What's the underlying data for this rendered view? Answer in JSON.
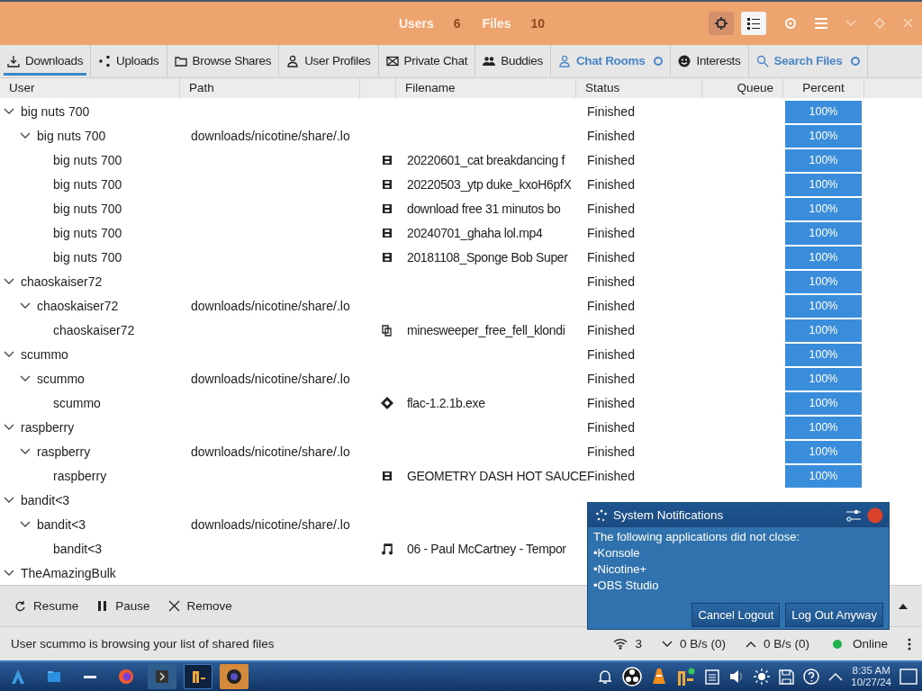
{
  "header": {
    "stats": [
      {
        "label": "Users",
        "value": "6"
      },
      {
        "label": "Files",
        "value": "10"
      }
    ],
    "view_toggle": [
      {
        "kind": "plugin",
        "selected": false
      },
      {
        "kind": "list",
        "selected": true
      }
    ]
  },
  "tabs": [
    {
      "label": "Downloads",
      "kind": "download",
      "selected": true,
      "highlighted": false,
      "dot": false
    },
    {
      "label": "Uploads",
      "kind": "share",
      "selected": false,
      "highlighted": false,
      "dot": false
    },
    {
      "label": "Browse Shares",
      "kind": "folder",
      "selected": false,
      "highlighted": false,
      "dot": false
    },
    {
      "label": "User Profiles",
      "kind": "person",
      "selected": false,
      "highlighted": false,
      "dot": false
    },
    {
      "label": "Private Chat",
      "kind": "mail",
      "selected": false,
      "highlighted": false,
      "dot": false
    },
    {
      "label": "Buddies",
      "kind": "people",
      "selected": false,
      "highlighted": false,
      "dot": false
    },
    {
      "label": "Chat Rooms",
      "kind": "person",
      "selected": false,
      "highlighted": true,
      "dot": true
    },
    {
      "label": "Interests",
      "kind": "smile",
      "selected": false,
      "highlighted": false,
      "dot": false
    },
    {
      "label": "Search Files",
      "kind": "search",
      "selected": false,
      "highlighted": true,
      "dot": true
    }
  ],
  "columns": [
    "User",
    "Path",
    "Filename",
    "Status",
    "Queue",
    "Percent"
  ],
  "rows": [
    {
      "user": "big nuts 700",
      "status": "Finished",
      "percent": "100%",
      "level": 1,
      "expanded": true,
      "children": [
        {
          "user": "big nuts 700",
          "path": "downloads/nicotine/share/.lo",
          "status": "Finished",
          "percent": "100%",
          "level": 1,
          "expanded": true,
          "children": [
            {
              "user": "big nuts 700",
              "kind": "video",
              "file": "20220601_cat breakdancing f",
              "status": "Finished",
              "percent": "100%",
              "level": 1
            },
            {
              "user": "big nuts 700",
              "kind": "video",
              "file": "20220503_ytp duke_kxoH6pfX",
              "status": "Finished",
              "percent": "100%",
              "level": 1
            },
            {
              "user": "big nuts 700",
              "kind": "video",
              "file": "download free 31 minutos bo",
              "status": "Finished",
              "percent": "100%",
              "level": 1
            },
            {
              "user": "big nuts 700",
              "kind": "video",
              "file": "20240701_ghaha lol.mp4",
              "status": "Finished",
              "percent": "100%",
              "level": 1
            },
            {
              "user": "big nuts 700",
              "kind": "video",
              "file": "20181108_Sponge Bob Super",
              "status": "Finished",
              "percent": "100%",
              "level": 1
            }
          ]
        }
      ]
    },
    {
      "user": "chaoskaiser72",
      "status": "Finished",
      "percent": "100%",
      "level": 1,
      "expanded": true,
      "children": [
        {
          "user": "chaoskaiser72",
          "path": "downloads/nicotine/share/.lo",
          "status": "Finished",
          "percent": "100%",
          "level": 1,
          "expanded": true,
          "children": [
            {
              "user": "chaoskaiser72",
              "kind": "document",
              "file": "minesweeper_free_fell_klondi",
              "status": "Finished",
              "percent": "100%",
              "level": 1
            }
          ]
        }
      ]
    },
    {
      "user": "scummo",
      "status": "Finished",
      "percent": "100%",
      "level": 1,
      "expanded": true,
      "children": [
        {
          "user": "scummo",
          "path": "downloads/nicotine/share/.lo",
          "status": "Finished",
          "percent": "100%",
          "level": 1,
          "expanded": true,
          "children": [
            {
              "user": "scummo",
              "kind": "executable",
              "file": "flac-1.2.1b.exe",
              "status": "Finished",
              "percent": "100%",
              "level": 1
            }
          ]
        }
      ]
    },
    {
      "user": "raspberry",
      "status": "Finished",
      "percent": "100%",
      "level": 1,
      "expanded": true,
      "children": [
        {
          "user": "raspberry",
          "path": "downloads/nicotine/share/.lo",
          "status": "Finished",
          "percent": "100%",
          "level": 1,
          "expanded": true,
          "children": [
            {
              "user": "raspberry",
              "kind": "video",
              "file": "GEOMETRY DASH HOT SAUCE",
              "status": "Finished",
              "percent": "100%",
              "level": 1
            }
          ]
        }
      ]
    },
    {
      "user": "bandit<3",
      "expanded": true,
      "children": [
        {
          "user": "bandit<3",
          "path": "downloads/nicotine/share/.lo",
          "expanded": true,
          "children": [
            {
              "user": "bandit<3",
              "kind": "audio",
              "file": "06 - Paul McCartney - Tempor"
            }
          ]
        }
      ]
    },
    {
      "user": "TheAmazingBulk",
      "expanded": true
    }
  ],
  "actions": [
    {
      "kind": "resume",
      "label": "Resume"
    },
    {
      "kind": "pause",
      "label": "Pause"
    },
    {
      "kind": "remove",
      "label": "Remove"
    }
  ],
  "status_bar": {
    "message": "User scummo is browsing your list of shared files",
    "connections": "3",
    "download": "0 B/s (0)",
    "upload": "0 B/s (0)",
    "status": "Online"
  },
  "notification": {
    "title": "System Notifications",
    "lines": [
      "The following applications did not close:",
      "•Konsole",
      "•Nicotine+",
      "•OBS Studio"
    ],
    "buttons": [
      "Cancel Logout",
      "Log Out Anyway"
    ]
  },
  "taskbar": {
    "apps": [
      {
        "kind": "launcher",
        "selected": false
      },
      {
        "kind": "files",
        "selected": false
      },
      {
        "kind": "bar",
        "selected": false
      },
      {
        "kind": "firefox",
        "selected": false
      },
      {
        "kind": "terminal",
        "selected": false
      },
      {
        "kind": "nicotine",
        "selected": true
      },
      {
        "kind": "obs",
        "selected": false
      }
    ],
    "time": "8:35 AM",
    "date": "10/27/24"
  }
}
